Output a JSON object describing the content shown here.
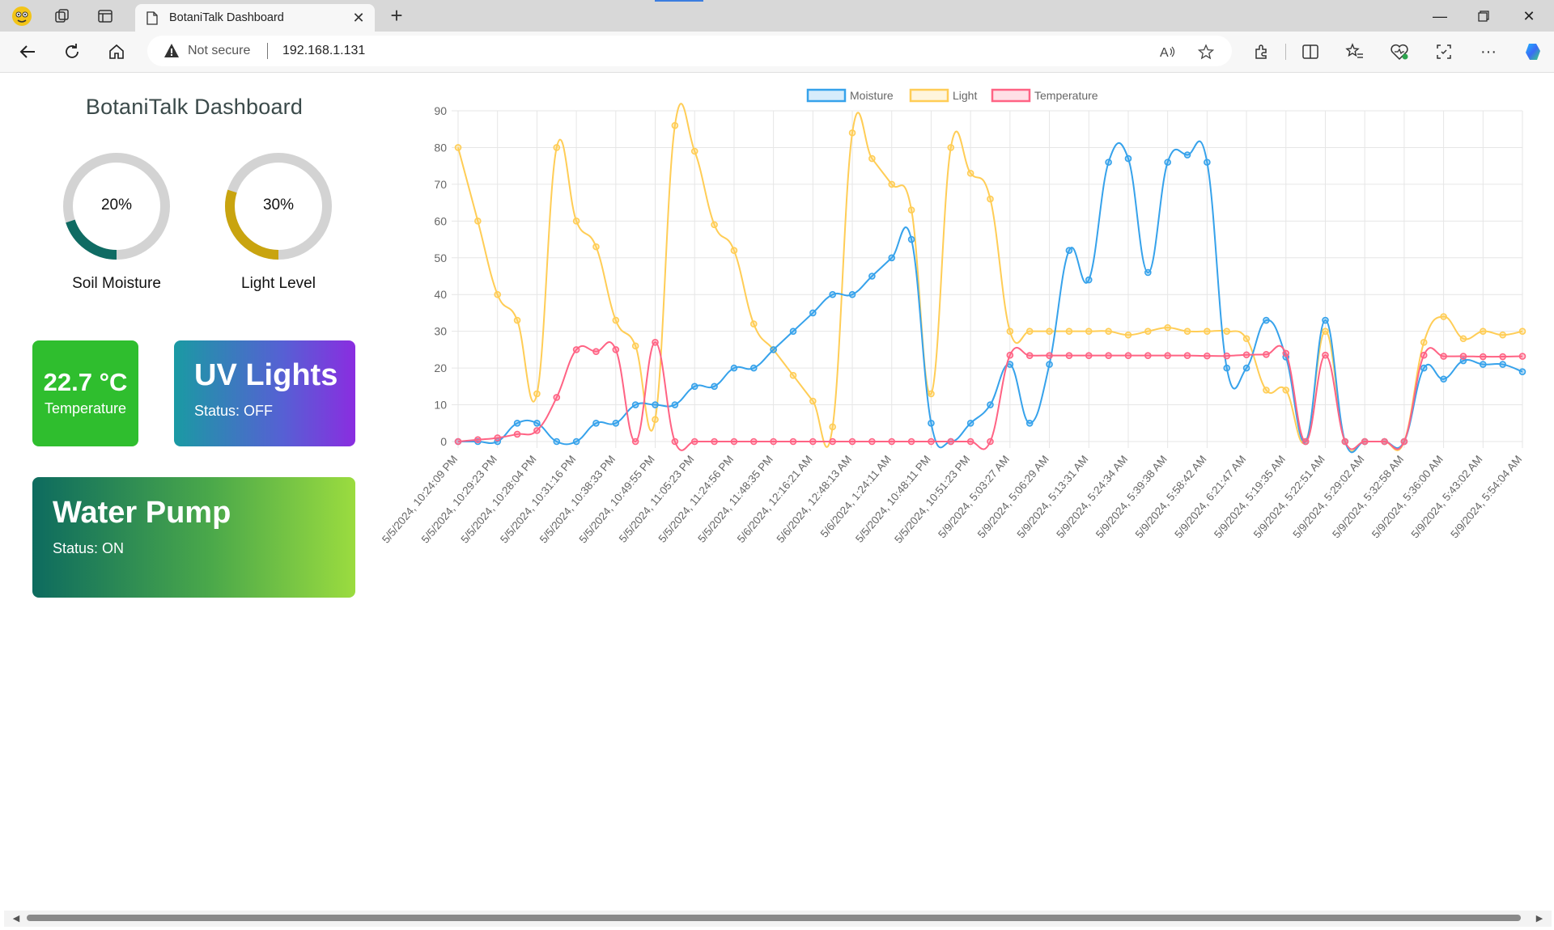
{
  "browser": {
    "tab_title": "BotaniTalk Dashboard",
    "security_label": "Not secure",
    "url": "192.168.1.131"
  },
  "dashboard": {
    "title": "BotaniTalk Dashboard",
    "soil": {
      "value": 20,
      "display": "20%",
      "label": "Soil Moisture",
      "color": "#0f6b63"
    },
    "light": {
      "value": 30,
      "display": "30%",
      "label": "Light Level",
      "color": "#c9a40f"
    },
    "temperature": {
      "value": "22.7 °C",
      "label": "Temperature"
    },
    "uv": {
      "title": "UV Lights",
      "status": "Status: OFF"
    },
    "pump": {
      "title": "Water Pump",
      "status": "Status: ON"
    }
  },
  "chart_data": {
    "type": "line",
    "legend_position": "top",
    "grid": true,
    "ylim": [
      0,
      90
    ],
    "yticks": [
      0,
      10,
      20,
      30,
      40,
      50,
      60,
      70,
      80,
      90
    ],
    "x_tick_labels": [
      "5/5/2024, 10:24:09 PM",
      "5/5/2024, 10:29:23 PM",
      "5/5/2024, 10:28:04 PM",
      "5/5/2024, 10:31:16 PM",
      "5/5/2024, 10:38:33 PM",
      "5/5/2024, 10:49:55 PM",
      "5/5/2024, 11:05:23 PM",
      "5/5/2024, 11:24:56 PM",
      "5/5/2024, 11:48:35 PM",
      "5/6/2024, 12:16:21 AM",
      "5/6/2024, 12:48:13 AM",
      "5/6/2024, 1:24:11 AM",
      "5/5/2024, 10:48:11 PM",
      "5/5/2024, 10:51:23 PM",
      "5/9/2024, 5:03:27 AM",
      "5/9/2024, 5:06:29 AM",
      "5/9/2024, 5:13:31 AM",
      "5/9/2024, 5:24:34 AM",
      "5/9/2024, 5:39:38 AM",
      "5/9/2024, 5:58:42 AM",
      "5/9/2024, 6:21:47 AM",
      "5/9/2024, 5:19:35 AM",
      "5/9/2024, 5:22:51 AM",
      "5/9/2024, 5:29:02 AM",
      "5/9/2024, 5:32:58 AM",
      "5/9/2024, 5:36:00 AM",
      "5/9/2024, 5:43:02 AM",
      "5/9/2024, 5:54:04 AM"
    ],
    "series": [
      {
        "name": "Moisture",
        "color": "#36a2eb",
        "values": [
          0,
          0,
          0,
          5,
          5,
          0,
          0,
          5,
          5,
          10,
          10,
          10,
          15,
          15,
          20,
          20,
          25,
          30,
          35,
          40,
          40,
          45,
          50,
          55,
          5,
          0,
          5,
          10,
          21,
          5,
          21,
          52,
          44,
          76,
          77,
          46,
          76,
          78,
          76,
          20,
          20,
          33,
          23,
          0,
          33,
          0,
          0,
          0,
          0,
          20,
          17,
          22,
          21,
          21,
          19
        ]
      },
      {
        "name": "Light",
        "color": "#ffcd56",
        "values": [
          80,
          60,
          40,
          33,
          13,
          80,
          60,
          53,
          33,
          26,
          6,
          86,
          79,
          59,
          52,
          32,
          25,
          18,
          11,
          4,
          84,
          77,
          70,
          63,
          13,
          80,
          73,
          66,
          30,
          30,
          30,
          30,
          30,
          30,
          29,
          30,
          31,
          30,
          30,
          30,
          28,
          14,
          14,
          0,
          30,
          0,
          0,
          0,
          0,
          27,
          34,
          28,
          30,
          29,
          30
        ]
      },
      {
        "name": "Temperature",
        "color": "#ff6384",
        "values": [
          0,
          0.5,
          1,
          2,
          3,
          12,
          25,
          24.5,
          25,
          0,
          27,
          0,
          0,
          0,
          0,
          0,
          0,
          0,
          0,
          0,
          0,
          0,
          0,
          0,
          0,
          0,
          0,
          0,
          23.5,
          23.4,
          23.4,
          23.4,
          23.4,
          23.4,
          23.4,
          23.4,
          23.4,
          23.4,
          23.3,
          23.3,
          23.6,
          23.7,
          24,
          0,
          23.5,
          0,
          0,
          0,
          0,
          23.5,
          23.2,
          23.2,
          23.1,
          23.1,
          23.2
        ]
      }
    ]
  }
}
